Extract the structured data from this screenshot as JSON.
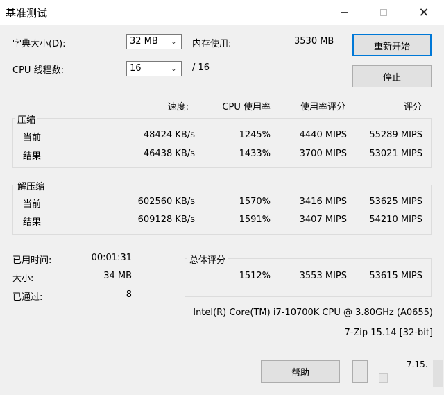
{
  "window": {
    "title": "基准测试"
  },
  "settings": {
    "dict_label": "字典大小(D):",
    "dict_value": "32 MB",
    "threads_label": "CPU 线程数:",
    "threads_value": "16",
    "threads_total": "/ 16",
    "mem_label": "内存使用:",
    "mem_value": "3530 MB"
  },
  "buttons": {
    "restart": "重新开始",
    "stop": "停止",
    "help": "帮助"
  },
  "table": {
    "headers": [
      "速度:",
      "CPU 使用率",
      "使用率评分",
      "评分"
    ],
    "compress": {
      "title": "压缩",
      "rows": [
        {
          "label": "当前",
          "speed": "48424 KB/s",
          "cpu": "1245%",
          "rating": "4440 MIPS",
          "score": "55289 MIPS"
        },
        {
          "label": "结果",
          "speed": "46438 KB/s",
          "cpu": "1433%",
          "rating": "3700 MIPS",
          "score": "53021 MIPS"
        }
      ]
    },
    "decompress": {
      "title": "解压缩",
      "rows": [
        {
          "label": "当前",
          "speed": "602560 KB/s",
          "cpu": "1570%",
          "rating": "3416 MIPS",
          "score": "53625 MIPS"
        },
        {
          "label": "结果",
          "speed": "609128 KB/s",
          "cpu": "1591%",
          "rating": "3407 MIPS",
          "score": "54210 MIPS"
        }
      ]
    }
  },
  "stats": {
    "elapsed_label": "已用时间:",
    "elapsed_value": "00:01:31",
    "size_label": "大小:",
    "size_value": "34 MB",
    "passes_label": "已通过:",
    "passes_value": "8"
  },
  "total": {
    "title": "总体评分",
    "cpu": "1512%",
    "rating": "3553 MIPS",
    "score": "53615 MIPS"
  },
  "cpu_info": "Intel(R) Core(TM) i7-10700K CPU @ 3.80GHz (A0655)",
  "version": "7-Zip 15.14 [32-bit]",
  "corner_mark": "7.15."
}
